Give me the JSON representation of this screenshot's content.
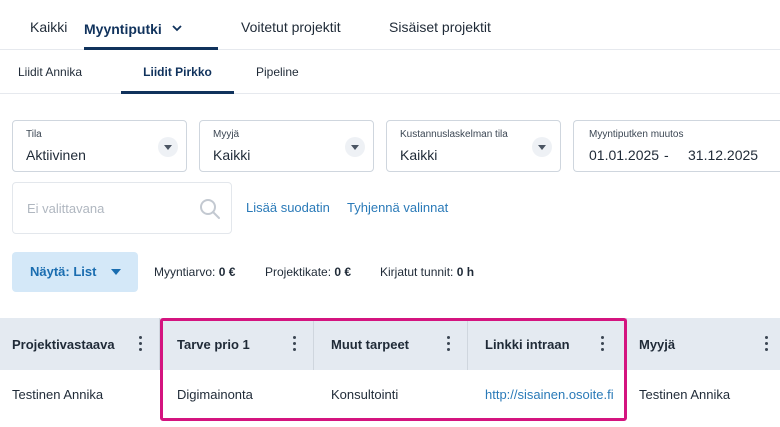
{
  "top_tabs": [
    {
      "label": "Kaikki"
    },
    {
      "label": "Myyntiputki"
    },
    {
      "label": "Voitetut projektit"
    },
    {
      "label": "Sisäiset projektit"
    }
  ],
  "sub_tabs": [
    {
      "label": "Liidit Annika"
    },
    {
      "label": "Liidit Pirkko"
    },
    {
      "label": "Pipeline"
    }
  ],
  "filters": {
    "tila": {
      "label": "Tila",
      "value": "Aktiivinen"
    },
    "myyja": {
      "label": "Myyjä",
      "value": "Kaikki"
    },
    "kustannus": {
      "label": "Kustannuslaskelman tila",
      "value": "Kaikki"
    },
    "muutos": {
      "label": "Myyntiputken muutos",
      "start": "01.01.2025",
      "separator": "-",
      "end": "31.12.2025"
    }
  },
  "search": {
    "placeholder": "Ei valittavana"
  },
  "actions": {
    "add_filter": "Lisää suodatin",
    "clear": "Tyhjennä valinnat"
  },
  "show_button": {
    "label": "Näytä: List"
  },
  "summary": {
    "sales_label": "Myyntiarvo:",
    "sales_value": "0 €",
    "margin_label": "Projektikate:",
    "margin_value": "0 €",
    "hours_label": "Kirjatut tunnit:",
    "hours_value": "0 h"
  },
  "table": {
    "columns": [
      "Projektivastaava",
      "Tarve prio 1",
      "Muut tarpeet",
      "Linkki intraan",
      "Myyjä"
    ],
    "rows": [
      [
        "Testinen Annika",
        "Digimainonta",
        "Konsultointi",
        "http://sisainen.osoite.fi",
        "Testinen Annika"
      ]
    ]
  },
  "colors": {
    "accent": "#10325c",
    "link": "#2a7ab8",
    "highlight": "#d4147f",
    "header_bg": "#e4eaf1"
  }
}
